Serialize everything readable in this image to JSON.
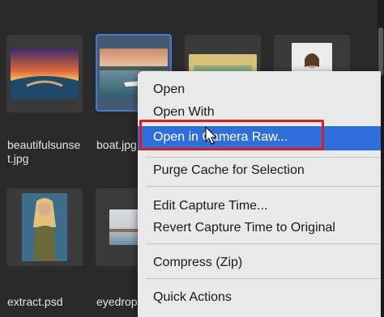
{
  "files": [
    {
      "name_line1": "beautifulsunse",
      "name_line2": "t.jpg"
    },
    {
      "name": "boat.jpg"
    },
    {
      "name": ""
    },
    {
      "name": ""
    },
    {
      "name": "extract.psd"
    },
    {
      "name": "eyedropper"
    }
  ],
  "context_menu": {
    "items": [
      {
        "label": "Open"
      },
      {
        "label": "Open With"
      },
      {
        "label": "Open in Camera Raw..."
      },
      {
        "label": "Purge Cache for Selection"
      },
      {
        "label": "Edit Capture Time..."
      },
      {
        "label": "Revert Capture Time to Original"
      },
      {
        "label": "Compress (Zip)"
      },
      {
        "label": "Quick Actions"
      }
    ]
  },
  "colors": {
    "highlight": "#2f6fdb",
    "annotation_box": "#e11b1b",
    "selected_border": "#3d7bd6"
  }
}
